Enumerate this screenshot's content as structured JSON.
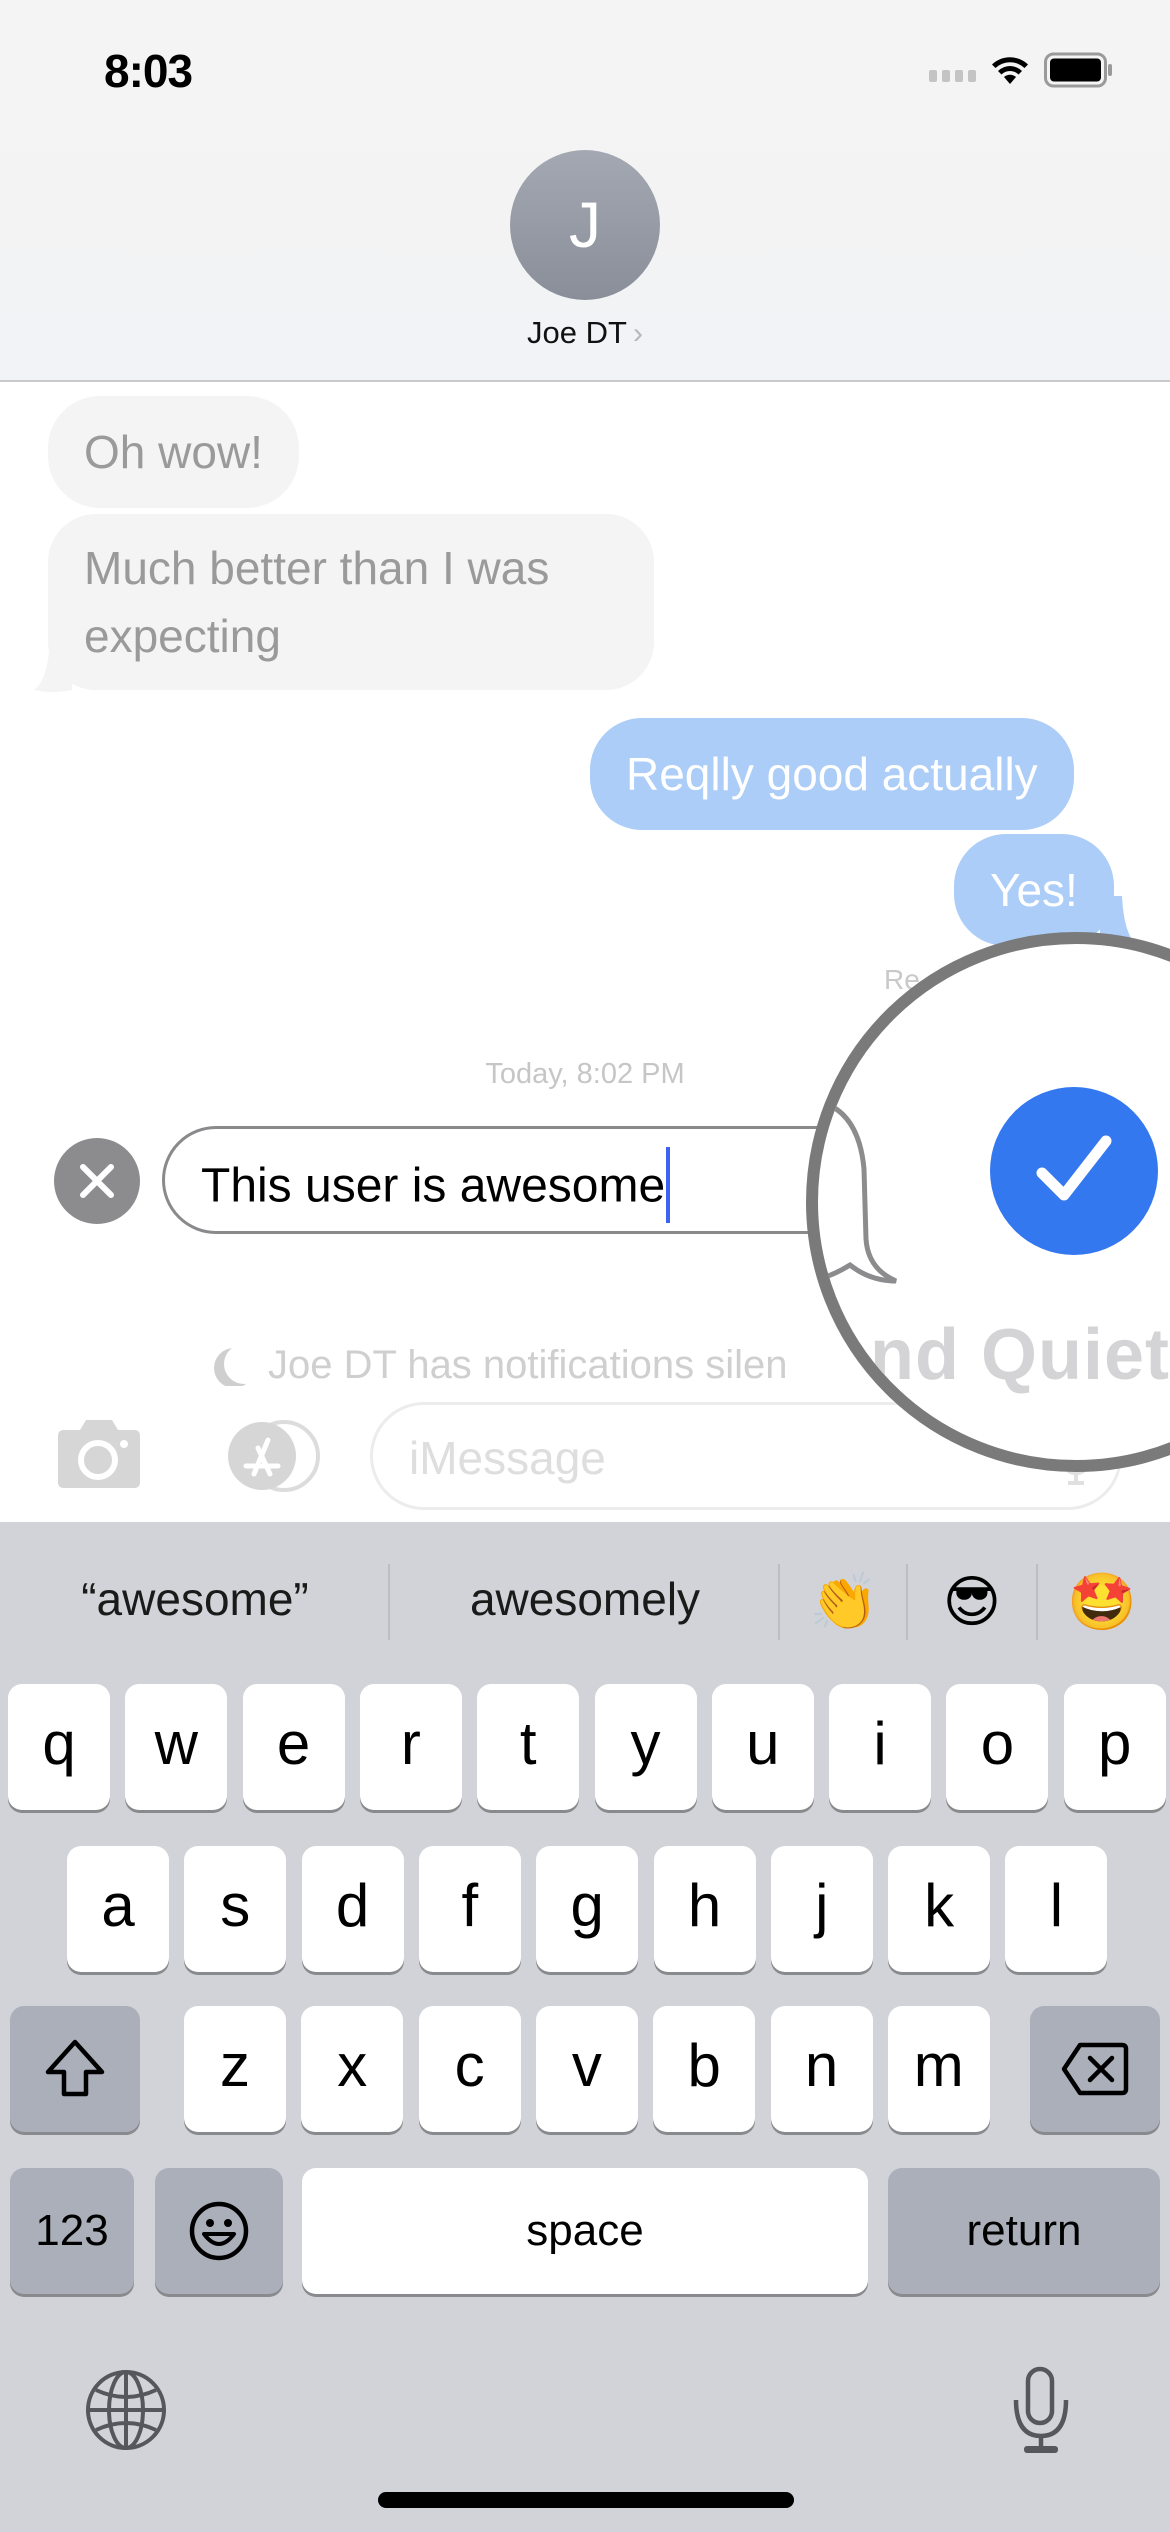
{
  "status_bar": {
    "time": "8:03",
    "signal_icon": "cellular-signal-icon",
    "wifi_icon": "wifi-icon",
    "battery_icon": "battery-icon"
  },
  "header": {
    "avatar_initial": "J",
    "contact_name": "Joe DT",
    "chevron": "›"
  },
  "messages": [
    {
      "direction": "incoming",
      "text": "Oh wow!"
    },
    {
      "direction": "incoming",
      "text": "Much better than I was expecting"
    },
    {
      "direction": "outgoing",
      "text": "Reqlly good actually"
    },
    {
      "direction": "outgoing",
      "text": "Yes!"
    }
  ],
  "read_receipt": "Re",
  "timestamp": "Today, 8:02 PM",
  "compose": {
    "text": "This user is awesome",
    "cancel_icon": "close-icon"
  },
  "silence_notice": "Joe DT has notifications silen",
  "input_bar": {
    "placeholder": "iMessage",
    "camera_icon": "camera-icon",
    "apps_icon": "app-store-icon",
    "mic_icon": "microphone-icon"
  },
  "magnifier": {
    "label": "nd Quietly",
    "check_icon": "checkmark-icon",
    "accent_color": "#3478f0"
  },
  "keyboard": {
    "predictions": [
      "“awesome”",
      "awesomely"
    ],
    "emoji_suggestions": [
      "👏",
      "😎",
      "🤩"
    ],
    "row1": [
      "q",
      "w",
      "e",
      "r",
      "t",
      "y",
      "u",
      "i",
      "o",
      "p"
    ],
    "row2": [
      "a",
      "s",
      "d",
      "f",
      "g",
      "h",
      "j",
      "k",
      "l"
    ],
    "row3": [
      "z",
      "x",
      "c",
      "v",
      "b",
      "n",
      "m"
    ],
    "numbers_label": "123",
    "space_label": "space",
    "return_label": "return"
  }
}
